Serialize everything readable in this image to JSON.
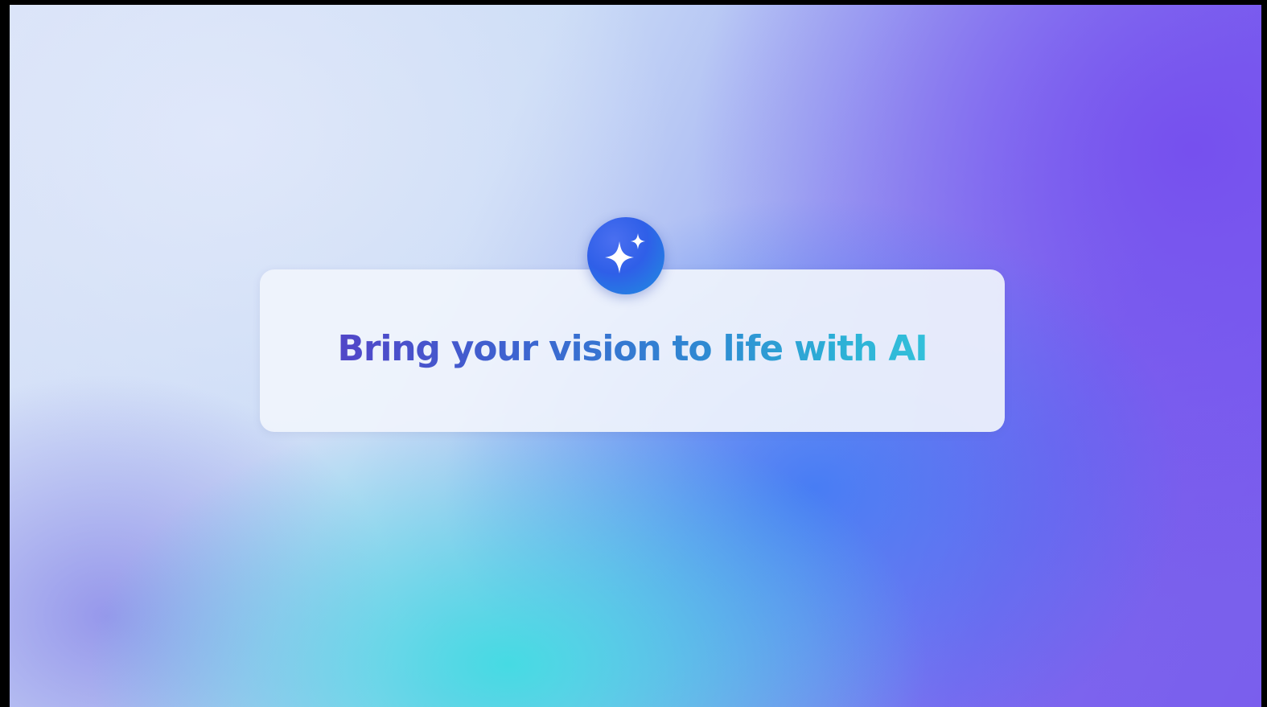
{
  "hero": {
    "headline": "Bring your vision to life with AI",
    "icon": "sparkles-icon"
  },
  "colors": {
    "headline_gradient_start": "#5146c8",
    "headline_gradient_end": "#33c0da",
    "badge": "#2f5fe8",
    "background_purple": "#7a5cee",
    "background_cyan": "#40dce2"
  }
}
